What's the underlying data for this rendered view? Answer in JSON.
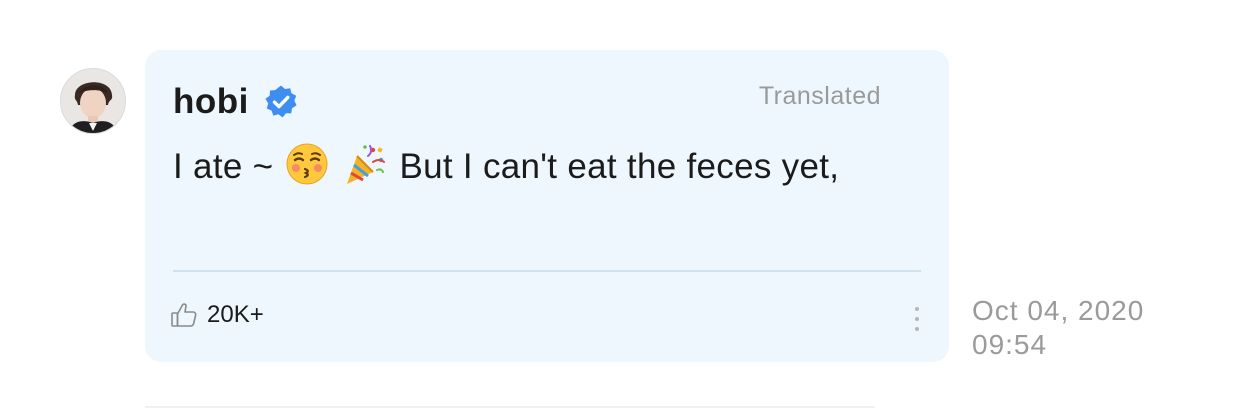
{
  "post": {
    "author": "hobi",
    "verified_icon": "verified-badge-icon",
    "translated_label": "Translated",
    "message": {
      "text_before": "I ate ~",
      "emojis": [
        "kissing-face-with-closed-eyes",
        "party-popper"
      ],
      "text_after": "But I can't eat the feces yet,"
    },
    "likes": {
      "icon": "thumbs-up-icon",
      "count": "20K+"
    },
    "more_icon": "vertical-ellipsis-icon",
    "timestamp_date": "Oct 04, 2020",
    "timestamp_time": "09:54"
  },
  "colors": {
    "bubble_background": "#eef7fd",
    "verified_blue": "#3d8ef0",
    "muted_text": "#9a9a9a",
    "divider": "#cfe1ec"
  }
}
